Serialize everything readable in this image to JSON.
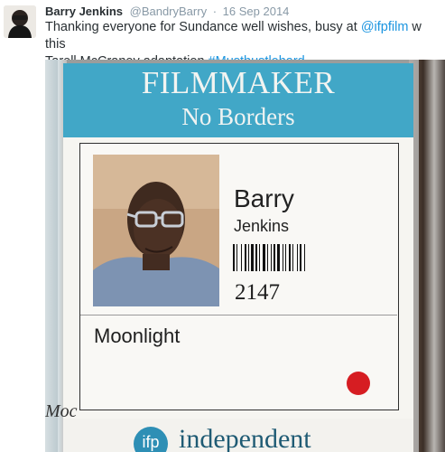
{
  "tweet": {
    "display_name": "Barry Jenkins",
    "handle": "@BandryBarry",
    "separator": "·",
    "date": "16 Sep 2014",
    "text_line1_before": "Thanking everyone for Sundance well wishes, busy at ",
    "mention": "@ifpfilm",
    "text_line1_after": " w this",
    "text_line2_before": "Tarell McCraney adaptation ",
    "hashtag": "#Musthustlehard"
  },
  "badge": {
    "title": "FILMMAKER",
    "subtitle": "No Borders",
    "first_name": "Barry",
    "last_name": "Jenkins",
    "id_number": "2147",
    "film": "Moonlight",
    "left_fragment": "Moc",
    "logo_text": "ifp",
    "footer_word": "independent"
  },
  "colors": {
    "link": "#1b95e0",
    "badge_header": "#41a7c7",
    "status_dot": "#d61d22"
  },
  "icons": {
    "avatar": "user-avatar"
  }
}
